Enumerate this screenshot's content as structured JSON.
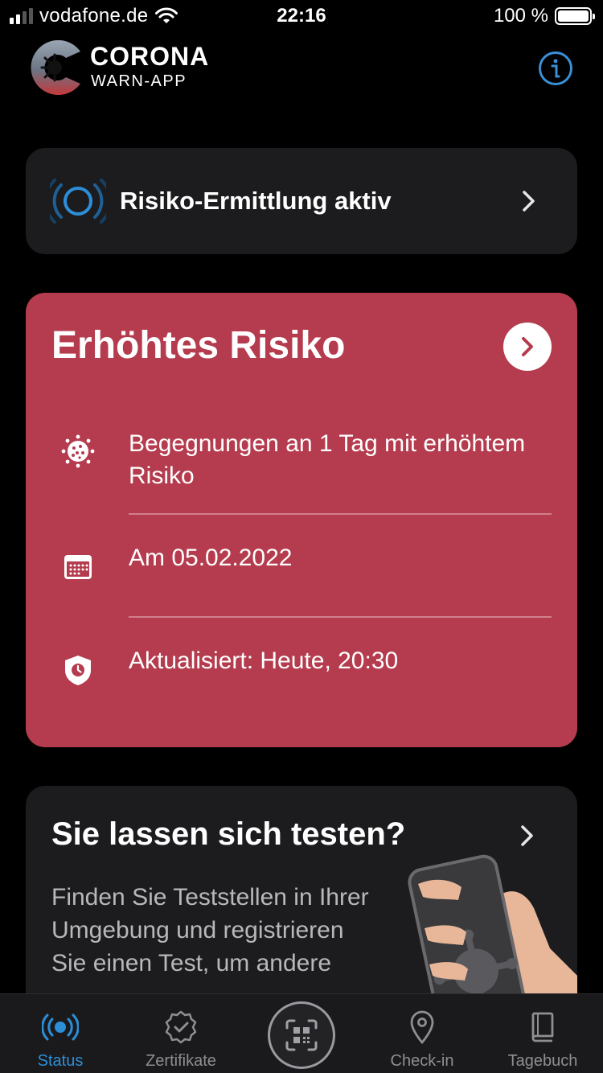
{
  "status_bar": {
    "carrier": "vodafone.de",
    "time": "22:16",
    "battery": "100 %",
    "icons": [
      "signal-icon",
      "wifi-icon",
      "battery-icon"
    ]
  },
  "header": {
    "brand_line1": "CORONA",
    "brand_line2": "WARN-APP",
    "icons": [
      "corona-logo-icon",
      "info-icon"
    ]
  },
  "tracing": {
    "label": "Risiko-Ermittlung aktiv",
    "icons": [
      "tracing-waves-icon",
      "chevron-right-icon"
    ]
  },
  "risk": {
    "title": "Erhöhtes Risiko",
    "rows": [
      {
        "icon": "virus-icon",
        "text": "Begegnungen an 1 Tag mit erhöhtem Risiko"
      },
      {
        "icon": "calendar-icon",
        "text": "Am 05.02.2022"
      },
      {
        "icon": "shield-clock-icon",
        "text": "Aktualisiert: Heute, 20:30"
      }
    ],
    "colors": {
      "background": "#b53c4e",
      "arrow_bg": "#ffffff"
    }
  },
  "test": {
    "title": "Sie lassen sich testen?",
    "body": "Finden Sie Teststellen in Ihrer Umgebung und registrieren Sie einen Test, um andere",
    "icons": [
      "hand-phone-illustration",
      "chevron-right-icon"
    ]
  },
  "tabbar": {
    "tabs": [
      {
        "label": "Status",
        "icon": "status-waves-icon",
        "active": true
      },
      {
        "label": "Zertifikate",
        "icon": "certificate-icon",
        "active": false
      },
      {
        "label": "",
        "icon": "qr-scan-icon",
        "active": false
      },
      {
        "label": "Check-in",
        "icon": "location-pin-icon",
        "active": false
      },
      {
        "label": "Tagebuch",
        "icon": "book-icon",
        "active": false
      }
    ],
    "accent": "#2d8ed8",
    "inactive": "#8e8e93"
  }
}
